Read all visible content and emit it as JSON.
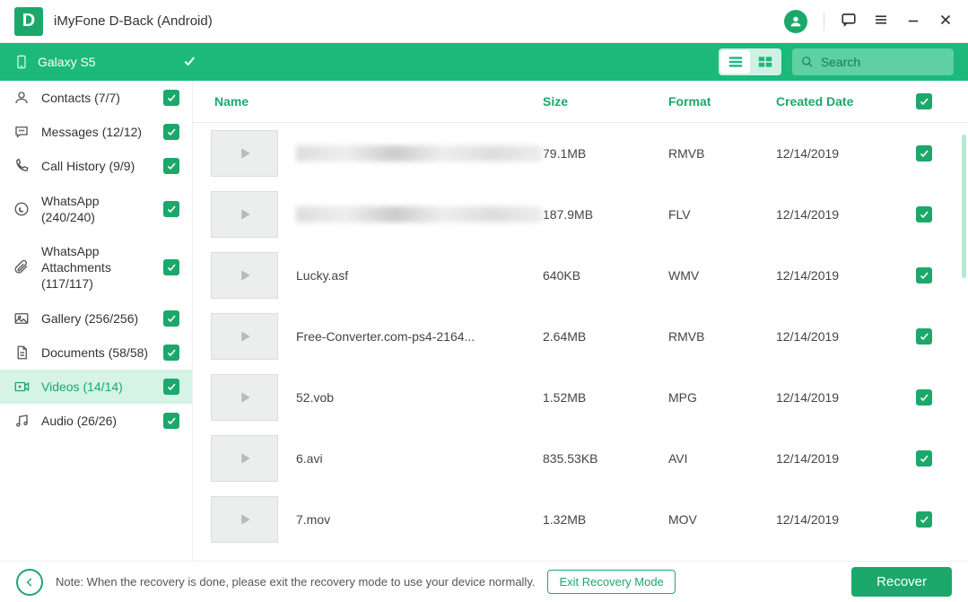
{
  "app": {
    "title": "iMyFone D-Back (Android)",
    "logo": "D"
  },
  "device": {
    "name": "Galaxy S5"
  },
  "search": {
    "placeholder": "Search"
  },
  "sidebar": {
    "items": [
      {
        "icon": "contact",
        "label": "Contacts (7/7)"
      },
      {
        "icon": "message",
        "label": "Messages (12/12)"
      },
      {
        "icon": "phone",
        "label": "Call History (9/9)"
      },
      {
        "icon": "whatsapp",
        "label": "WhatsApp (240/240)"
      },
      {
        "icon": "attach",
        "label": "WhatsApp Attachments (117/117)"
      },
      {
        "icon": "gallery",
        "label": "Gallery (256/256)"
      },
      {
        "icon": "doc",
        "label": "Documents (58/58)"
      },
      {
        "icon": "video",
        "label": "Videos (14/14)"
      },
      {
        "icon": "audio",
        "label": "Audio (26/26)"
      }
    ]
  },
  "columns": {
    "name": "Name",
    "size": "Size",
    "format": "Format",
    "date": "Created Date"
  },
  "rows": [
    {
      "name": "████████████",
      "size": "79.1MB",
      "format": "RMVB",
      "date": "12/14/2019",
      "blur": true
    },
    {
      "name": "███████",
      "size": "187.9MB",
      "format": "FLV",
      "date": "12/14/2019",
      "blur": true
    },
    {
      "name": "Lucky.asf",
      "size": "640KB",
      "format": "WMV",
      "date": "12/14/2019"
    },
    {
      "name": "Free-Converter.com-ps4-2164...",
      "size": "2.64MB",
      "format": "RMVB",
      "date": "12/14/2019"
    },
    {
      "name": "52.vob",
      "size": "1.52MB",
      "format": "MPG",
      "date": "12/14/2019"
    },
    {
      "name": "6.avi",
      "size": "835.53KB",
      "format": "AVI",
      "date": "12/14/2019"
    },
    {
      "name": "7.mov",
      "size": "1.32MB",
      "format": "MOV",
      "date": "12/14/2019"
    }
  ],
  "footer": {
    "note": "Note: When the recovery is done, please exit the recovery mode to use your device normally.",
    "exit": "Exit Recovery Mode",
    "recover": "Recover"
  }
}
